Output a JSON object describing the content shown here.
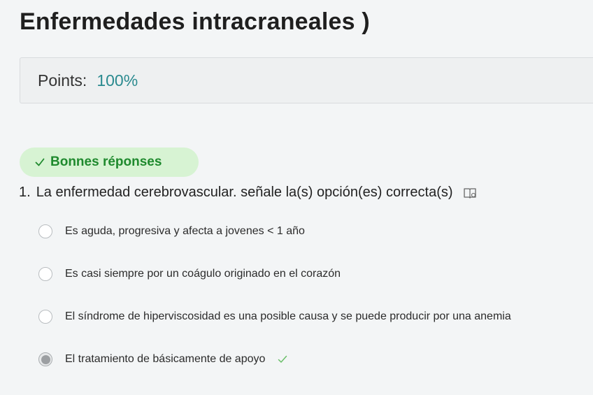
{
  "quiz": {
    "title": "Enfermedades intracraneales )",
    "points_label": "Points:",
    "points_value": "100%"
  },
  "result_badge": {
    "label": "Bonnes réponses",
    "color": "#1f8a2e",
    "background": "#d7f3d3"
  },
  "question": {
    "number": "1.",
    "text": "La enfermedad cerebrovascular. señale la(s) opción(es) correcta(s)",
    "options": [
      {
        "label": "Es aguda, progresiva y afecta a jovenes < 1 año",
        "selected": false,
        "correct": false
      },
      {
        "label": "Es casi  siempre por un coágulo originado en el corazón",
        "selected": false,
        "correct": false
      },
      {
        "label": "El síndrome de hiperviscosidad es una posible causa y se puede producir por una anemia",
        "selected": false,
        "correct": false
      },
      {
        "label": "El tratamiento de básicamente de apoyo",
        "selected": true,
        "correct": true
      }
    ]
  },
  "icons": {
    "badge": "check-icon",
    "question": "book-icon",
    "correct_mark": "check-icon"
  },
  "colors": {
    "accent": "#2a8a8f",
    "correct": "#1f8a2e"
  }
}
